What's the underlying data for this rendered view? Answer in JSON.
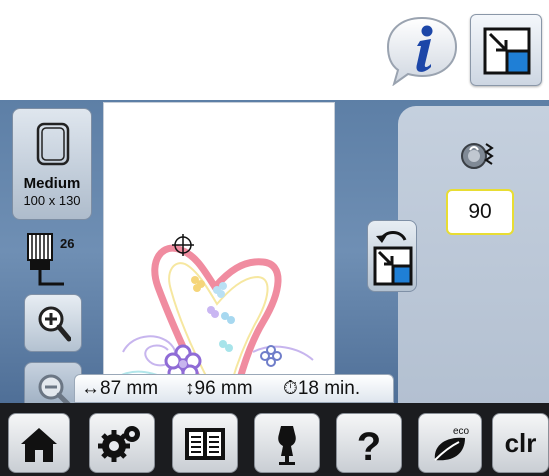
{
  "toolbar": {
    "info_icon": "info-icon",
    "corner_icon": "move-to-corner-icon"
  },
  "hoop": {
    "label": "Medium",
    "size": "100 x 130"
  },
  "presser_foot": {
    "number": "26"
  },
  "design_info": {
    "width": "↔87 mm",
    "height": "↕96 mm",
    "time": "⏱18 min."
  },
  "tension": {
    "value": "90"
  },
  "bottom_nav": [
    {
      "name": "home-icon"
    },
    {
      "name": "settings-icon"
    },
    {
      "name": "tutorial-icon"
    },
    {
      "name": "sewing-consultant-icon"
    },
    {
      "name": "help-icon"
    },
    {
      "name": "eco-icon"
    },
    {
      "label": "clr"
    }
  ],
  "colors": {
    "panel": "#5d7fa6",
    "accent": "#1a5fa6",
    "tension_border": "#e8dd33",
    "bottom_bar": "#1b1c1f"
  }
}
